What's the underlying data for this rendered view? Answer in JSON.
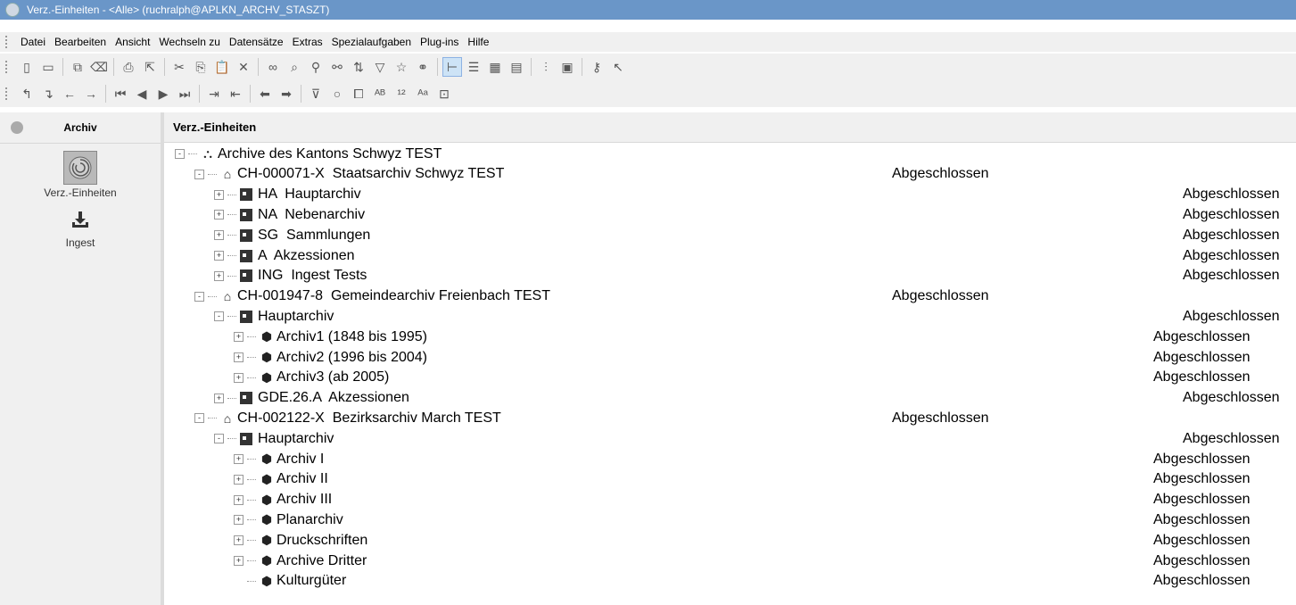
{
  "window": {
    "title": "Verz.-Einheiten - <Alle> (ruchralph@APLKN_ARCHV_STASZT)"
  },
  "menu": [
    "Datei",
    "Bearbeiten",
    "Ansicht",
    "Wechseln zu",
    "Datensätze",
    "Extras",
    "Spezialaufgaben",
    "Plug-ins",
    "Hilfe"
  ],
  "toolbar1_icons": [
    "new-icon",
    "save-icon",
    "sep",
    "copy-record-icon",
    "delete-record-icon",
    "sep",
    "print-icon",
    "export-icon",
    "sep",
    "cut-icon",
    "copy-icon",
    "paste-icon",
    "delete-icon",
    "sep",
    "search-icon",
    "find-replace-icon",
    "filter-icon",
    "binoculars-icon",
    "sort-icon",
    "funnel-icon",
    "star-icon",
    "link-icon",
    "sep",
    "tree-view-icon",
    "list-view-icon",
    "grid-view-icon",
    "form-view-icon",
    "sep",
    "chart-icon",
    "report-icon",
    "sep",
    "key-icon",
    "help-pointer-icon"
  ],
  "toolbar2_icons": [
    "level-up-icon",
    "level-down-icon",
    "back-icon",
    "forward-icon",
    "sep",
    "first-icon",
    "prev-icon",
    "next-icon",
    "last-icon",
    "sep",
    "indent-icon",
    "outdent-icon",
    "sep",
    "arrow-left-icon",
    "arrow-right-icon",
    "sep",
    "filter-clear-icon",
    "circle-icon",
    "window-icon",
    "abc-icon",
    "number-sort-icon",
    "case-icon",
    "field-icon"
  ],
  "left_panel": {
    "header": "Archiv",
    "items": [
      {
        "label": "Verz.-Einheiten",
        "icon": "archive-shell-icon"
      },
      {
        "label": "Ingest",
        "icon": "download-icon"
      }
    ]
  },
  "right_panel": {
    "header": "Verz.-Einheiten"
  },
  "tree": [
    {
      "level": 0,
      "exp": "-",
      "icon": "sitemap-icon",
      "label": "Archive des Kantons Schwyz TEST",
      "status": ""
    },
    {
      "level": 1,
      "exp": "-",
      "icon": "home-icon",
      "label": "CH-000071-X  Staatsarchiv Schwyz TEST",
      "status": "Abgeschlossen",
      "scol": 0
    },
    {
      "level": 2,
      "exp": "+",
      "icon": "box-icon",
      "label": "HA  Hauptarchiv",
      "status": "Abgeschlossen",
      "scol": 2
    },
    {
      "level": 2,
      "exp": "+",
      "icon": "box-icon",
      "label": "NA  Nebenarchiv",
      "status": "Abgeschlossen",
      "scol": 2
    },
    {
      "level": 2,
      "exp": "+",
      "icon": "box-icon",
      "label": "SG  Sammlungen",
      "status": "Abgeschlossen",
      "scol": 2
    },
    {
      "level": 2,
      "exp": "+",
      "icon": "box-icon",
      "label": "A  Akzessionen",
      "status": "Abgeschlossen",
      "scol": 2
    },
    {
      "level": 2,
      "exp": "+",
      "icon": "box-icon",
      "label": "ING  Ingest Tests",
      "status": "Abgeschlossen",
      "scol": 2
    },
    {
      "level": 1,
      "exp": "-",
      "icon": "home-icon",
      "label": "CH-001947-8  Gemeindearchiv Freienbach TEST",
      "status": "Abgeschlossen",
      "scol": 0
    },
    {
      "level": 2,
      "exp": "-",
      "icon": "box-icon",
      "label": "Hauptarchiv",
      "status": "Abgeschlossen",
      "scol": 2
    },
    {
      "level": 3,
      "exp": "+",
      "icon": "cube-icon",
      "label": "Archiv1 (1848 bis 1995)",
      "status": "Abgeschlossen",
      "scol": 1
    },
    {
      "level": 3,
      "exp": "+",
      "icon": "cube-icon",
      "label": "Archiv2 (1996 bis 2004)",
      "status": "Abgeschlossen",
      "scol": 1
    },
    {
      "level": 3,
      "exp": "+",
      "icon": "cube-icon",
      "label": "Archiv3 (ab 2005)",
      "status": "Abgeschlossen",
      "scol": 1
    },
    {
      "level": 2,
      "exp": "+",
      "icon": "box-icon",
      "label": "GDE.26.A  Akzessionen",
      "status": "Abgeschlossen",
      "scol": 2
    },
    {
      "level": 1,
      "exp": "-",
      "icon": "home-icon",
      "label": "CH-002122-X  Bezirksarchiv March TEST",
      "status": "Abgeschlossen",
      "scol": 0
    },
    {
      "level": 2,
      "exp": "-",
      "icon": "box-icon",
      "label": "Hauptarchiv",
      "status": "Abgeschlossen",
      "scol": 2
    },
    {
      "level": 3,
      "exp": "+",
      "icon": "cube-icon",
      "label": "Archiv I",
      "status": "Abgeschlossen",
      "scol": 1
    },
    {
      "level": 3,
      "exp": "+",
      "icon": "cube-icon",
      "label": "Archiv II",
      "status": "Abgeschlossen",
      "scol": 1
    },
    {
      "level": 3,
      "exp": "+",
      "icon": "cube-icon",
      "label": "Archiv III",
      "status": "Abgeschlossen",
      "scol": 1
    },
    {
      "level": 3,
      "exp": "+",
      "icon": "cube-icon",
      "label": "Planarchiv",
      "status": "Abgeschlossen",
      "scol": 1
    },
    {
      "level": 3,
      "exp": "+",
      "icon": "cube-icon",
      "label": "Druckschriften",
      "status": "Abgeschlossen",
      "scol": 1
    },
    {
      "level": 3,
      "exp": "+",
      "icon": "cube-icon",
      "label": "Archive Dritter",
      "status": "Abgeschlossen",
      "scol": 1
    },
    {
      "level": 3,
      "exp": "",
      "icon": "cube-icon",
      "label": "Kulturgüter",
      "status": "Abgeschlossen",
      "scol": 1
    }
  ]
}
